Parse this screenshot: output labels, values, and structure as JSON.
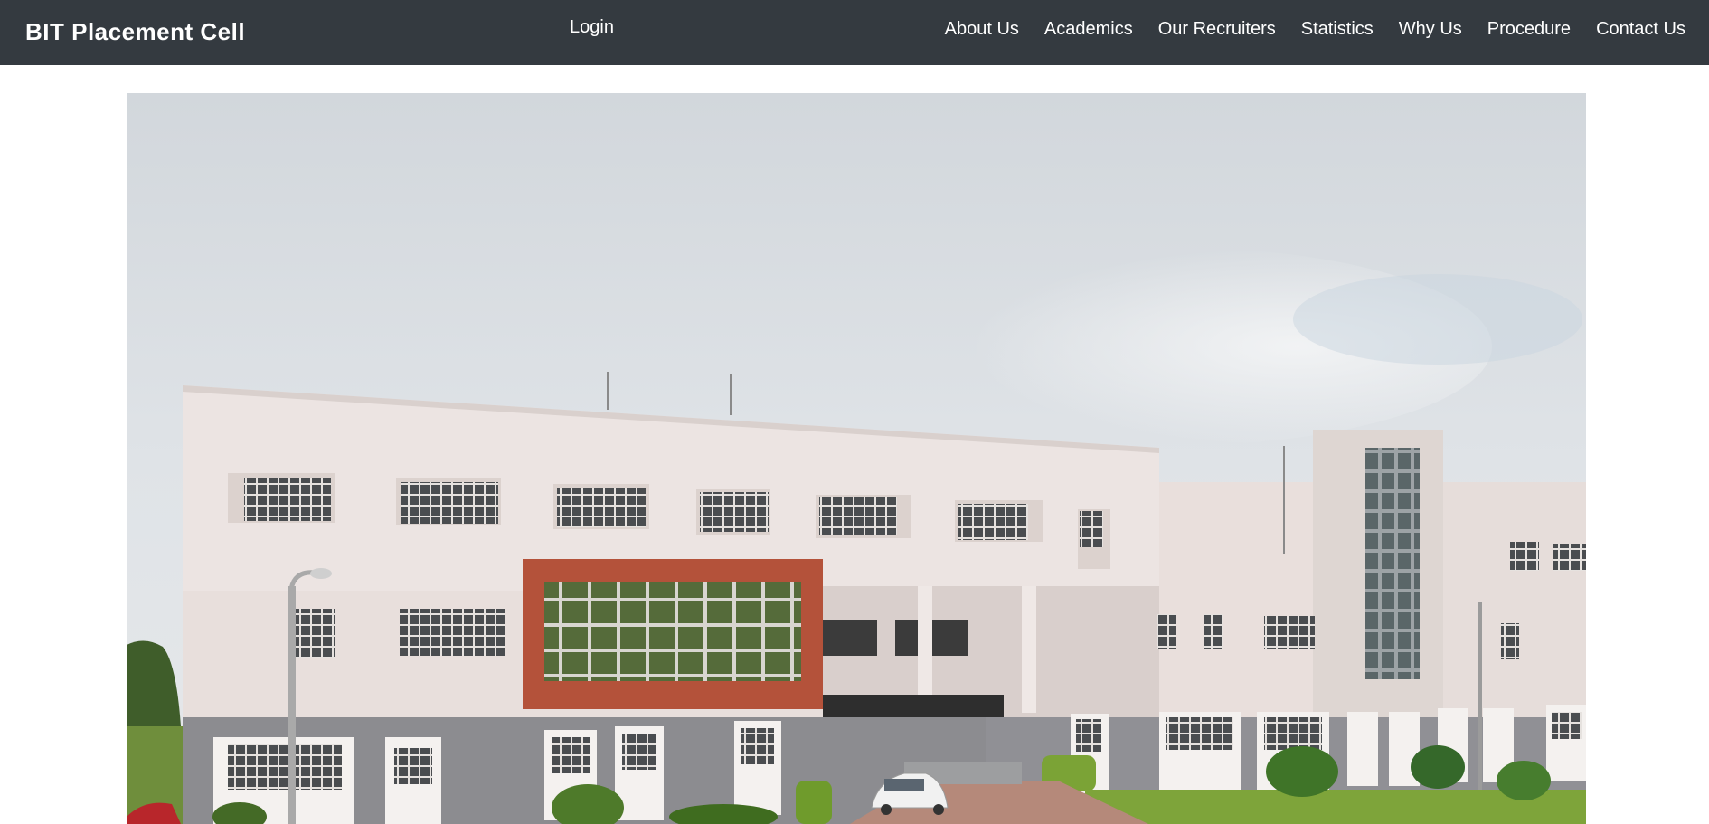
{
  "navbar": {
    "brand": "BIT Placement Cell",
    "login_label": "Login",
    "links": [
      {
        "label": "About Us"
      },
      {
        "label": "Academics"
      },
      {
        "label": "Our Recruiters"
      },
      {
        "label": "Statistics"
      },
      {
        "label": "Why Us"
      },
      {
        "label": "Procedure"
      },
      {
        "label": "Contact Us"
      }
    ]
  },
  "hero": {
    "image_subject": "campus-building-photo"
  },
  "colors": {
    "navbar_bg": "#343a40",
    "nav_text": "#ffffff",
    "page_bg": "#ffffff"
  }
}
